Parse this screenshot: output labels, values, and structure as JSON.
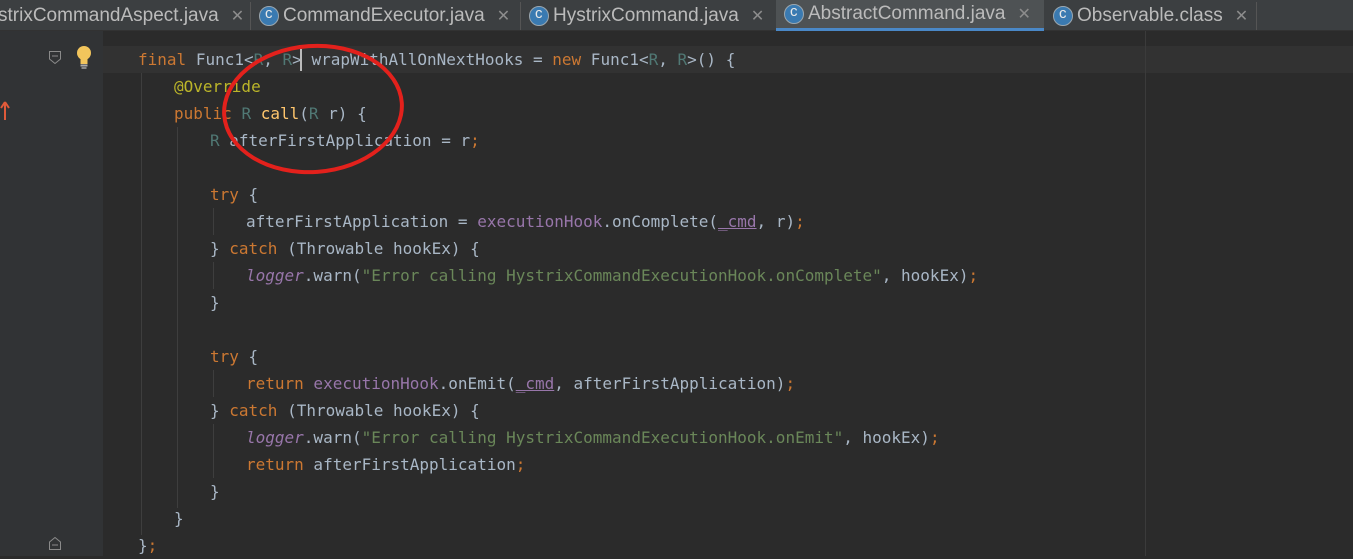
{
  "tabs": [
    {
      "label": "strixCommandAspect.java",
      "active": false,
      "icon": "none"
    },
    {
      "label": "CommandExecutor.java",
      "active": false,
      "icon": "java-class-icon"
    },
    {
      "label": "HystrixCommand.java",
      "active": false,
      "icon": "java-class-icon"
    },
    {
      "label": "AbstractCommand.java",
      "active": true,
      "icon": "java-class-icon"
    },
    {
      "label": "Observable.class",
      "active": false,
      "icon": "java-class-icon"
    }
  ],
  "close_glyph": "✕",
  "icons": {
    "bulb": "lightbulb-icon",
    "override": "override-arrow-icon",
    "fold": "fold-marker-icon"
  },
  "colors": {
    "keyword": "#cc7832",
    "annotation": "#bbb529",
    "field": "#9876aa",
    "string": "#6a8759",
    "method": "#ffc66d",
    "type_param": "#507874",
    "circle": "#e3211c",
    "active_tab_underline": "#4a88c7"
  },
  "code": {
    "l1": {
      "final": "final",
      "func1": "Func1",
      "lt": "<",
      "R1": "R",
      "comma": ", ",
      "R2": "R",
      "gt": "> ",
      "name": "wrapWithAllOnNextHooks",
      "eq": " = ",
      "new": "new",
      "func1b": " Func1",
      "lt2": "<",
      "R3": "R",
      "comma2": ", ",
      "R4": "R",
      "gt2": ">() {"
    },
    "l2": {
      "ann": "@Override"
    },
    "l3": {
      "public": "public",
      "R": "R",
      "call": "call",
      "open": "(",
      "R2": "R",
      "rest": " r) {"
    },
    "l4": {
      "R": "R",
      "rest": " afterFirstApplication = r",
      "semi": ";"
    },
    "l6": {
      "try": "try",
      "rest": " {"
    },
    "l7": {
      "a": "afterFirstApplication = ",
      "hook": "executionHook",
      "b": ".onComplete(",
      "cmd": "_cmd",
      "c": ", r)",
      "semi": ";"
    },
    "l8": {
      "a": "} ",
      "catch": "catch",
      "b": " (Throwable hookEx) {"
    },
    "l9": {
      "logger": "logger",
      "a": ".warn(",
      "str": "\"Error calling HystrixCommandExecutionHook.onComplete\"",
      "b": ", hookEx)",
      "semi": ";"
    },
    "l10": {
      "a": "}"
    },
    "l12": {
      "try": "try",
      "rest": " {"
    },
    "l13": {
      "return": "return",
      "hook": " executionHook",
      "b": ".onEmit(",
      "cmd": "_cmd",
      "c": ", afterFirstApplication)",
      "semi": ";"
    },
    "l14": {
      "a": "} ",
      "catch": "catch",
      "b": " (Throwable hookEx) {"
    },
    "l15": {
      "logger": "logger",
      "a": ".warn(",
      "str": "\"Error calling HystrixCommandExecutionHook.onEmit\"",
      "b": ", hookEx)",
      "semi": ";"
    },
    "l16": {
      "return": "return",
      "a": " afterFirstApplication",
      "semi": ";"
    },
    "l17": {
      "a": "}"
    },
    "l18": {
      "a": "}"
    },
    "l19": {
      "a": "}",
      "semi": ";"
    }
  }
}
